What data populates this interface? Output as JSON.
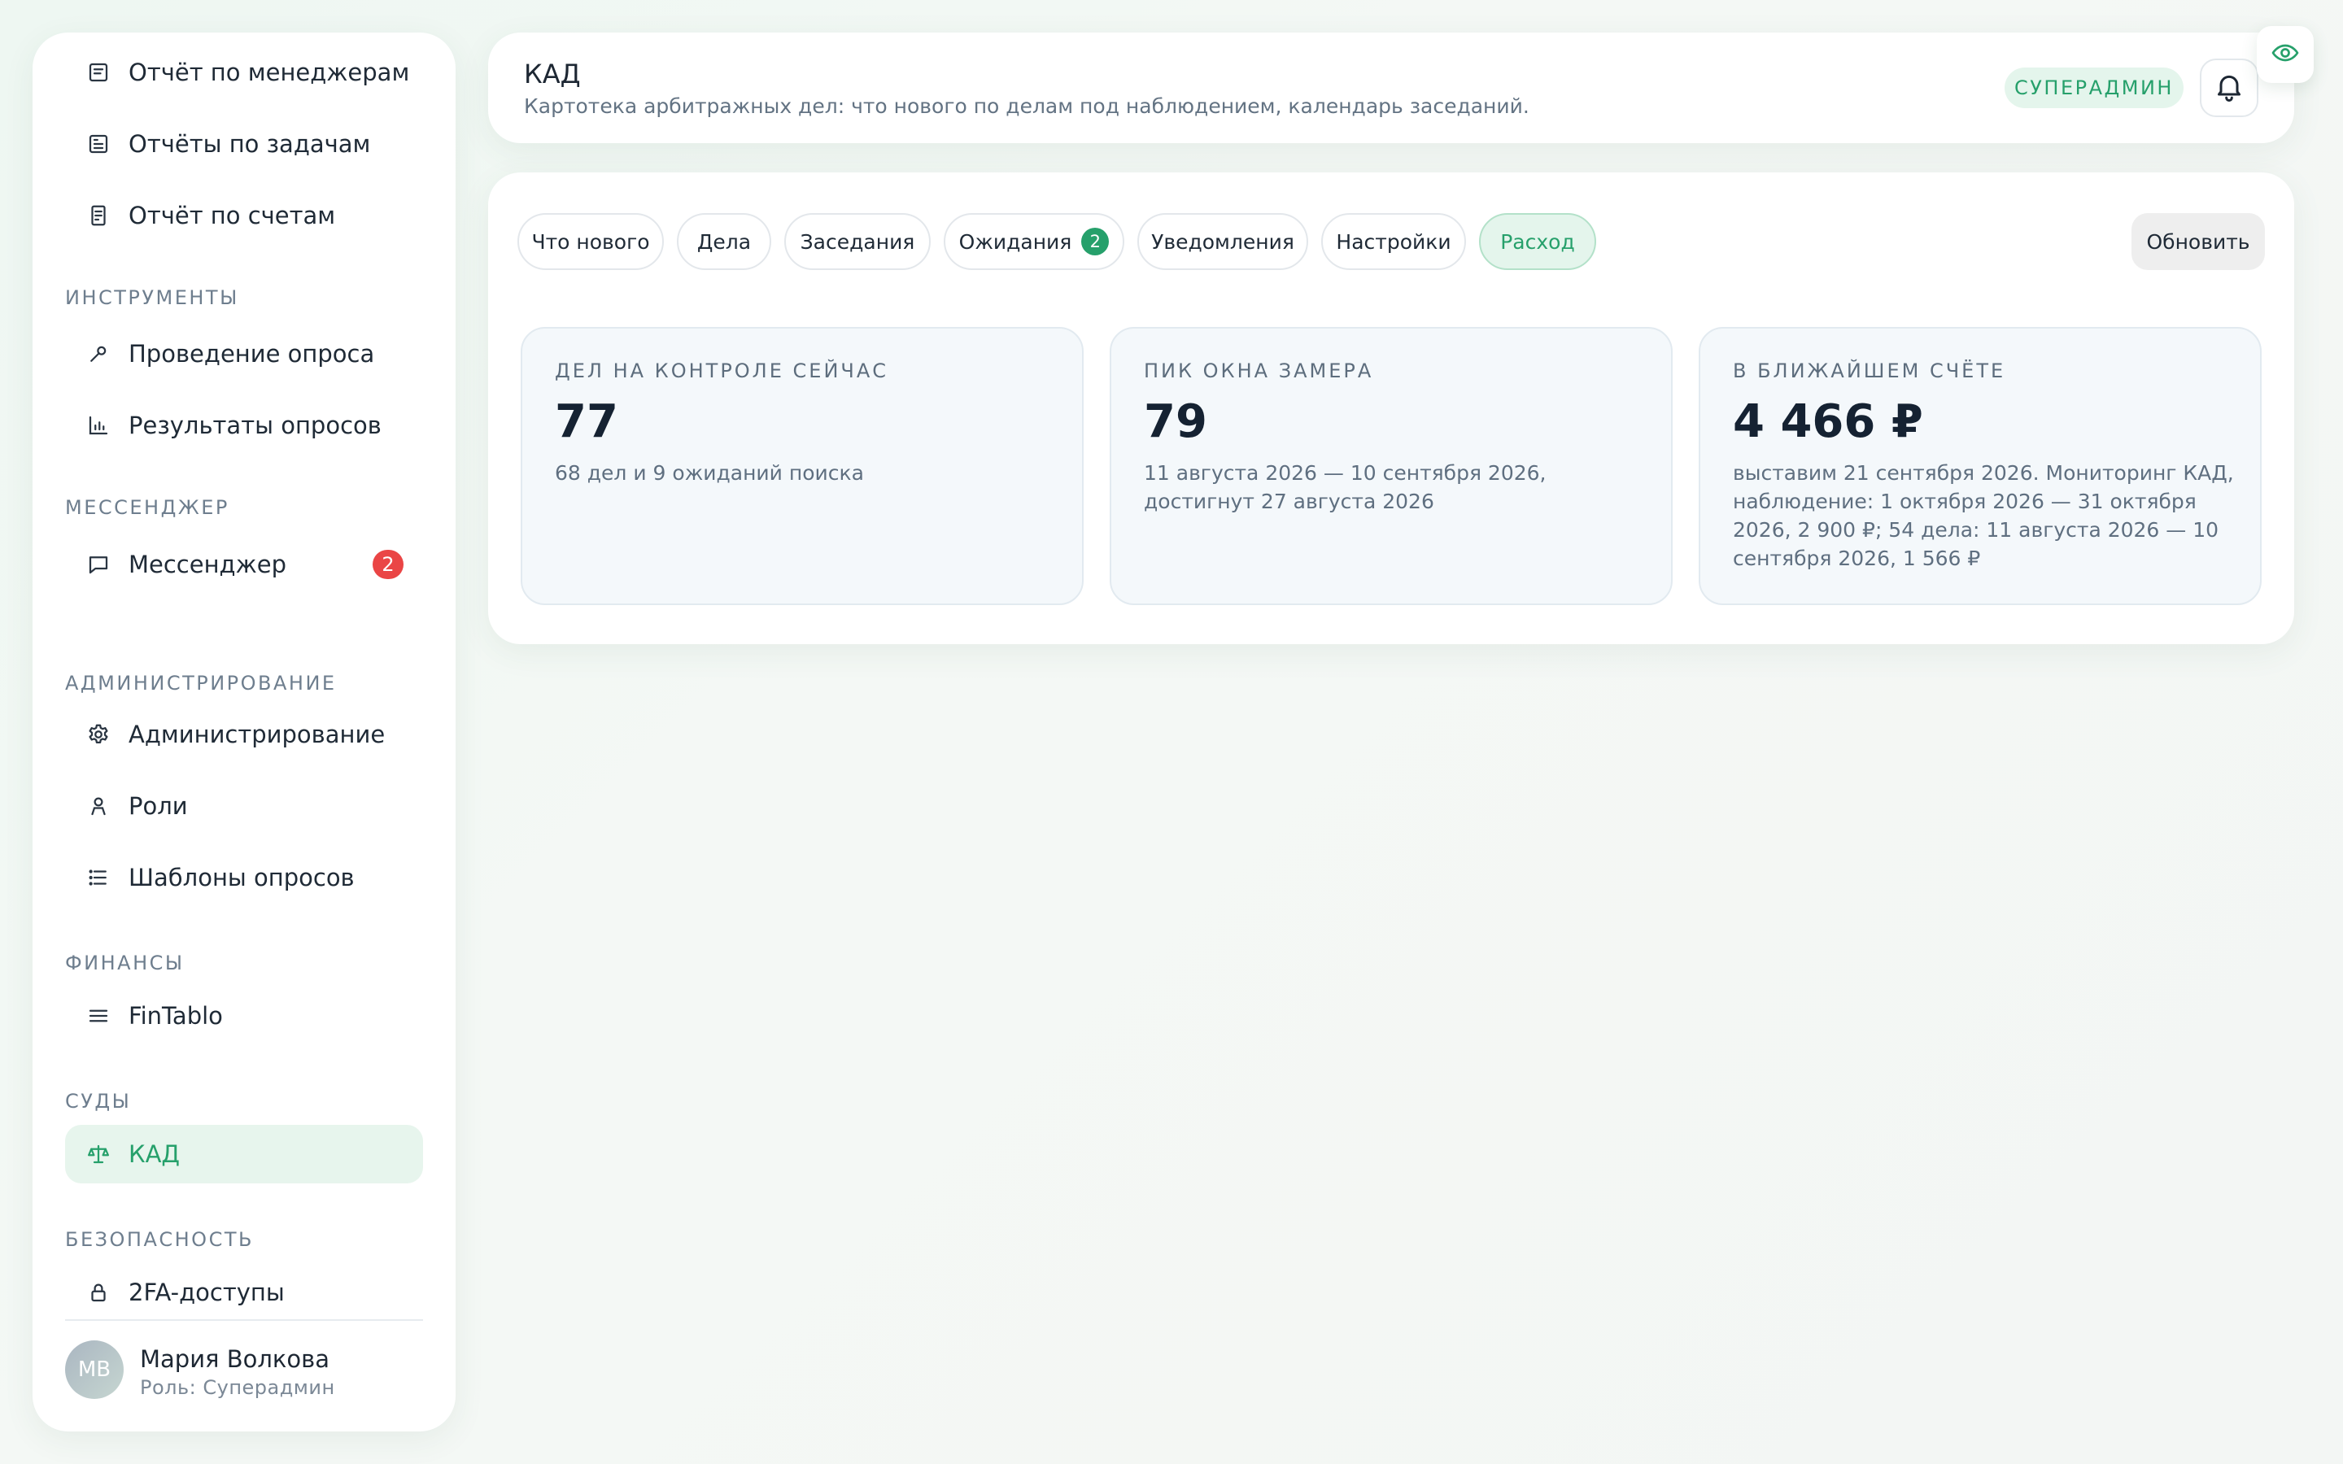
{
  "sidebar": {
    "items": [
      {
        "label": "Отчёт по менеджерам",
        "icon": "report-icon"
      },
      {
        "label": "Отчёты по задачам",
        "icon": "task-report-icon"
      },
      {
        "label": "Отчёт по счетам",
        "icon": "invoice-icon"
      },
      {
        "label": "Проведение опроса",
        "icon": "wrench-icon"
      },
      {
        "label": "Результаты опросов",
        "icon": "bar-chart-icon"
      },
      {
        "label": "Мессенджер",
        "icon": "chat-icon",
        "badge": "2"
      },
      {
        "label": "Администрирование",
        "icon": "gear-icon"
      },
      {
        "label": "Роли",
        "icon": "person-icon"
      },
      {
        "label": "Шаблоны опросов",
        "icon": "list-icon"
      },
      {
        "label": "FinTablo",
        "icon": "menu-icon"
      },
      {
        "label": "КАД",
        "icon": "scales-icon",
        "active": true
      },
      {
        "label": "2FA-доступы",
        "icon": "lock-icon"
      }
    ],
    "sections": {
      "tools": "ИНСТРУМЕНТЫ",
      "messenger": "МЕССЕНДЖЕР",
      "admin": "АДМИНИСТРИРОВАНИЕ",
      "finance": "ФИНАНСЫ",
      "courts": "СУДЫ",
      "security": "БЕЗОПАСНОСТЬ"
    },
    "user": {
      "initials": "МВ",
      "name": "Мария Волкова",
      "role": "Роль: Суперадмин"
    }
  },
  "header": {
    "title": "КАД",
    "subtitle": "Картотека арбитражных дел: что нового по делам под наблюдением, календарь заседаний.",
    "role_badge": "СУПЕРАДМИН"
  },
  "tabs": [
    {
      "label": "Что нового"
    },
    {
      "label": "Дела"
    },
    {
      "label": "Заседания"
    },
    {
      "label": "Ожидания",
      "badge": "2"
    },
    {
      "label": "Уведомления"
    },
    {
      "label": "Настройки"
    },
    {
      "label": "Расход",
      "active": true
    }
  ],
  "refresh_label": "Обновить",
  "stats": [
    {
      "label": "ДЕЛ НА КОНТРОЛЕ СЕЙЧАС",
      "value": "77",
      "description": "68 дел и 9 ожиданий поиска"
    },
    {
      "label": "ПИК ОКНА ЗАМЕРА",
      "value": "79",
      "description": "11 августа 2026 — 10 сентября 2026, достигнут 27 августа 2026"
    },
    {
      "label": "В БЛИЖАЙШЕМ СЧЁТЕ",
      "value": "4 466 ₽",
      "description": "выставим 21 сентября 2026. Мониторинг КАД, наблюдение: 1 октября 2026 — 31 октября 2026, 2 900 ₽; 54 дела: 11 августа 2026 — 10 сентября 2026, 1 566 ₽"
    }
  ],
  "colors": {
    "accent": "#26a06b",
    "accent_bg": "#e4f5ec",
    "badge_red": "#ea4545",
    "text_primary": "#1d2733",
    "text_muted": "#637383"
  }
}
